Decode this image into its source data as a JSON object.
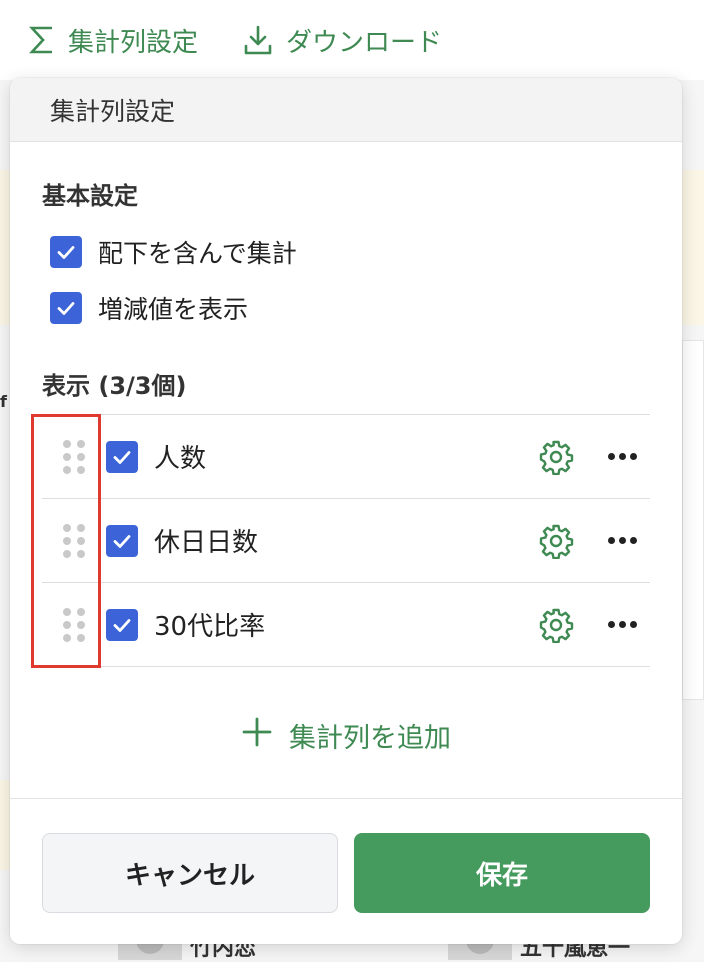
{
  "toolbar": {
    "aggregate_settings_label": "集計列設定",
    "download_label": "ダウンロード"
  },
  "panel": {
    "title": "集計列設定",
    "basic_section": {
      "title": "基本設定",
      "options": [
        {
          "label": "配下を含んで集計",
          "checked": true
        },
        {
          "label": "増減値を表示",
          "checked": true
        }
      ]
    },
    "display_section": {
      "title": "表示 (3/3個)",
      "columns": [
        {
          "label": "人数",
          "checked": true
        },
        {
          "label": "休日日数",
          "checked": true
        },
        {
          "label": "30代比率",
          "checked": true
        }
      ]
    },
    "add_column_label": "集計列を追加",
    "cancel_label": "キャンセル",
    "save_label": "保存"
  },
  "background": {
    "partial_letter": "f",
    "partial_names": [
      "竹内恋",
      "五十嵐恵一"
    ]
  },
  "colors": {
    "accent_green": "#3e8a52",
    "save_green": "#459a5e",
    "checkbox_blue": "#3c64d8",
    "highlight_red": "#e03a2e"
  }
}
